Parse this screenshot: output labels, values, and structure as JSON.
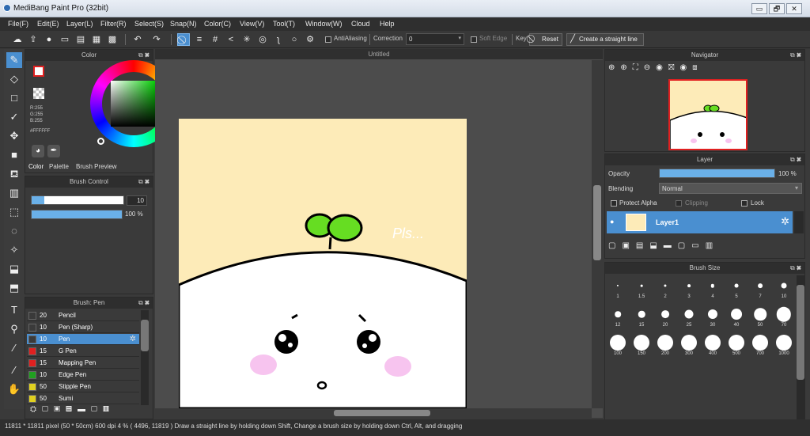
{
  "window": {
    "title": "MediBang Paint Pro (32bit)",
    "min": "▭",
    "max": "🗗",
    "close": "✕"
  },
  "menu": [
    "File(F)",
    "Edit(E)",
    "Layer(L)",
    "Filter(R)",
    "Select(S)",
    "Snap(N)",
    "Color(C)",
    "View(V)",
    "Tool(T)",
    "Window(W)",
    "Cloud",
    "Help"
  ],
  "toolbar": {
    "antialiasing_label": "AntiAliasing",
    "correction_label": "Correction",
    "correction_value": "0",
    "soft_edge_label": "Soft Edge",
    "key_label": "Key",
    "reset_label": "Reset",
    "straight_line_label": "Create a straight line"
  },
  "color_panel": {
    "title": "Color",
    "r": "R:255",
    "g": "G:255",
    "b": "B:255",
    "hex": "#FFFFFF",
    "tabs": [
      "Color",
      "Palette",
      "Brush Preview"
    ]
  },
  "brush_control": {
    "title": "Brush Control",
    "size_value": "10",
    "opacity_value": "100 %",
    "size_fraction": 0.14,
    "opacity_fraction": 1.0
  },
  "brush_panel": {
    "title": "Brush: Pen",
    "items": [
      {
        "size": "20",
        "name": "Pencil",
        "color": "#3a3a3a"
      },
      {
        "size": "10",
        "name": "Pen (Sharp)",
        "color": "#3a3a3a"
      },
      {
        "size": "10",
        "name": "Pen",
        "color": "#3a3a3a"
      },
      {
        "size": "15",
        "name": "G Pen",
        "color": "#e02020"
      },
      {
        "size": "15",
        "name": "Mapping Pen",
        "color": "#e02020"
      },
      {
        "size": "10",
        "name": "Edge Pen",
        "color": "#20a020"
      },
      {
        "size": "50",
        "name": "Stipple Pen",
        "color": "#e0d020"
      },
      {
        "size": "50",
        "name": "Sumi",
        "color": "#e0d020"
      }
    ]
  },
  "canvas": {
    "tab_title": "Untitled",
    "artwork_text": "Pls..."
  },
  "navigator": {
    "title": "Navigator"
  },
  "layer_panel": {
    "title": "Layer",
    "opacity_label": "Opacity",
    "opacity_value": "100 %",
    "opacity_fraction": 1.0,
    "blending_label": "Blending",
    "blending_value": "Normal",
    "protect_alpha": "Protect Alpha",
    "clipping": "Clipping",
    "lock": "Lock",
    "layer_name": "Layer1"
  },
  "brush_size_panel": {
    "title": "Brush Size",
    "sizes": [
      "1",
      "1.5",
      "2",
      "3",
      "4",
      "5",
      "7",
      "10",
      "12",
      "15",
      "20",
      "25",
      "30",
      "40",
      "50",
      "70",
      "100",
      "150",
      "200",
      "300",
      "400",
      "500",
      "700",
      "1000"
    ]
  },
  "status": {
    "text": "11811 * 11811 pixel  (50 * 50cm)  600 dpi  4 %  ( 4496, 11819 )  Draw a straight line by holding down Shift, Change a brush size by holding down Ctrl, Alt, and dragging"
  }
}
